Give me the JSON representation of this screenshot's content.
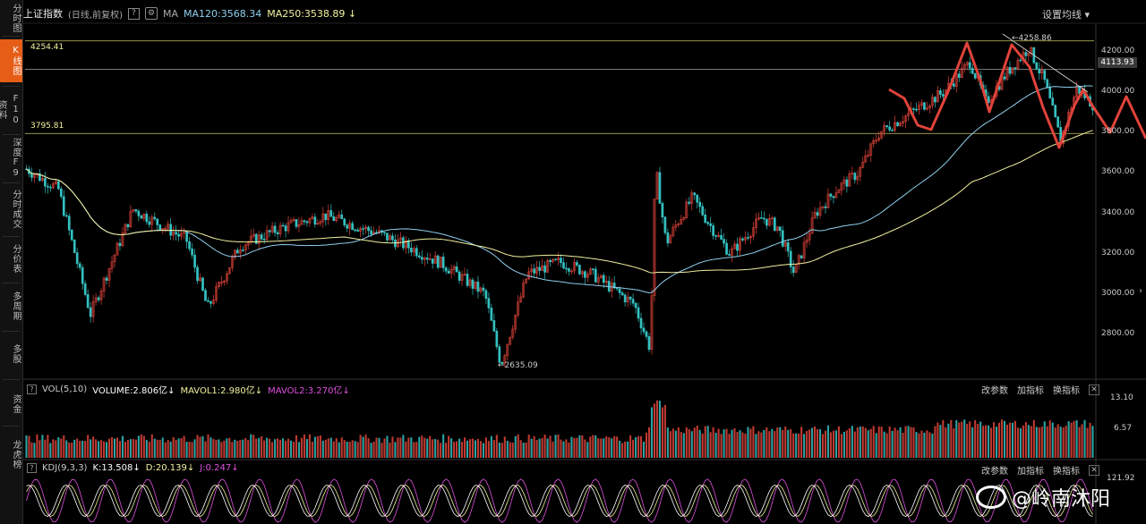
{
  "sidebar": {
    "items": [
      {
        "label": "分时图"
      },
      {
        "label": "K线图",
        "active": true
      },
      {
        "label": "F10资料"
      },
      {
        "label": "深度F9"
      },
      {
        "label": "分时成交"
      },
      {
        "label": "分价表"
      },
      {
        "label": "多周期"
      },
      {
        "label": "多股"
      },
      {
        "label": "资金"
      },
      {
        "label": "龙虎榜"
      }
    ]
  },
  "header": {
    "title": "上证指数",
    "subtitle": "(日线,前复权)",
    "ma_label": "MA",
    "ma120": "MA120:3568.34",
    "ma250": "MA250:3538.89",
    "settings": "设置均线"
  },
  "price_chart": {
    "levels": [
      {
        "label": "4254.41",
        "value": 4254.41
      },
      {
        "label": "3795.81",
        "value": 3795.81
      },
      {
        "value": 4113.93
      }
    ],
    "current_price": "4113.93",
    "high_annotation": "4258.86",
    "low_annotation": "2635.09",
    "y_ticks": [
      "4200.00",
      "4000.00",
      "3800.00",
      "3600.00",
      "3400.00",
      "3200.00",
      "3000.00",
      "2800.00"
    ]
  },
  "vol_panel": {
    "name": "VOL(5,10)",
    "volume": "VOLUME:2.806亿",
    "mavol1": "MAVOL1:2.980亿",
    "mavol2": "MAVOL2:3.270亿",
    "ticks": [
      "13.10",
      "6.57"
    ],
    "actions": [
      "改参数",
      "加指标",
      "换指标"
    ]
  },
  "kdj_panel": {
    "name": "KDJ(9,3,3)",
    "k": "K:13.508",
    "d": "D:20.139",
    "j": "J:0.247",
    "tick": "121.92",
    "actions": [
      "改参数",
      "加指标",
      "换指标"
    ]
  },
  "watermark": "@岭南沐阳",
  "colors": {
    "up": "#e0433a",
    "down": "#34c0c0",
    "ma120": "#8fd0f0",
    "ma250": "#f2f2a0",
    "active_tab": "#e55d16",
    "annotation": "#e0433a"
  }
}
